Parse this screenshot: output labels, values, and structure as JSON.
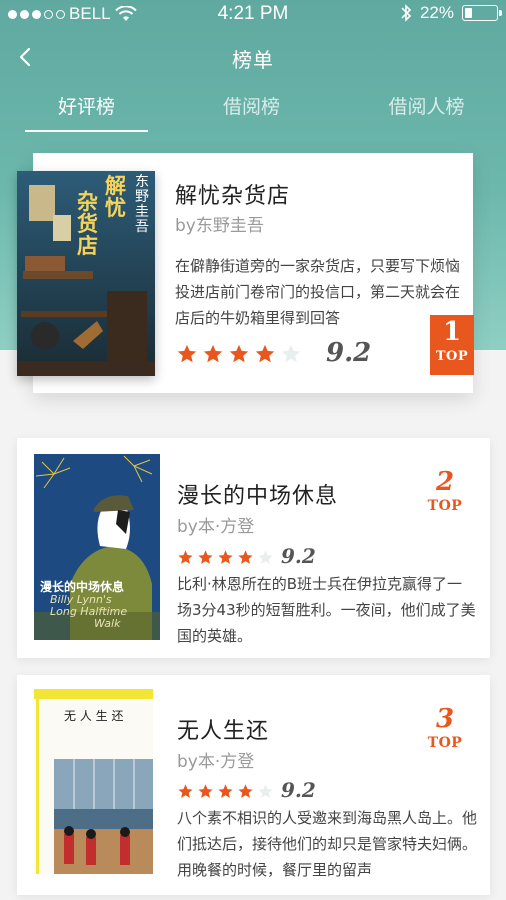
{
  "status": {
    "carrier": "BELL",
    "time": "4:21 PM",
    "battery": "22%",
    "battery_level": 0.22
  },
  "nav": {
    "title": "榜单"
  },
  "tabs": [
    {
      "label": "好评榜",
      "active": true
    },
    {
      "label": "借阅榜",
      "active": false
    },
    {
      "label": "借阅人榜",
      "active": false
    }
  ],
  "colors": {
    "accent": "#e8571e",
    "header": "#6db8ad",
    "star_off": "#e9eeee"
  },
  "books": [
    {
      "title": "解忧杂货店",
      "author": "by东野圭吾",
      "desc": "在僻静街道旁的一家杂货店，只要写下烦恼投进店前门卷帘门的投信口，第二天就会在店后的牛奶箱里得到回答",
      "stars": 4,
      "score": "9.2",
      "rank": "1",
      "rank_label": "TOP",
      "cover": {
        "title_a": "解忧",
        "title_b": "杂货店",
        "author": "东野圭吾"
      }
    },
    {
      "title": "漫长的中场休息",
      "author": "by本·方登",
      "desc": "比利·林恩所在的B班士兵在伊拉克赢得了一场3分43秒的短暂胜利。一夜间，他们成了美国的英雄。",
      "stars": 4,
      "score": "9.2",
      "rank": "2",
      "rank_label": "TOP",
      "cover": {
        "title": "漫长的中场休息",
        "subtitle_a": "Billy Lynn's",
        "subtitle_b": "Long Halftime",
        "subtitle_c": "Walk"
      }
    },
    {
      "title": "无人生还",
      "author": "by本·方登",
      "desc": "八个素不相识的人受邀来到海岛黑人岛上。他们抵达后，接待他们的却只是管家特夫妇俩。用晚餐的时候，餐厅里的留声",
      "stars": 4,
      "score": "9.2",
      "rank": "3",
      "rank_label": "TOP",
      "cover": {
        "title": "无 人 生 还"
      }
    }
  ]
}
